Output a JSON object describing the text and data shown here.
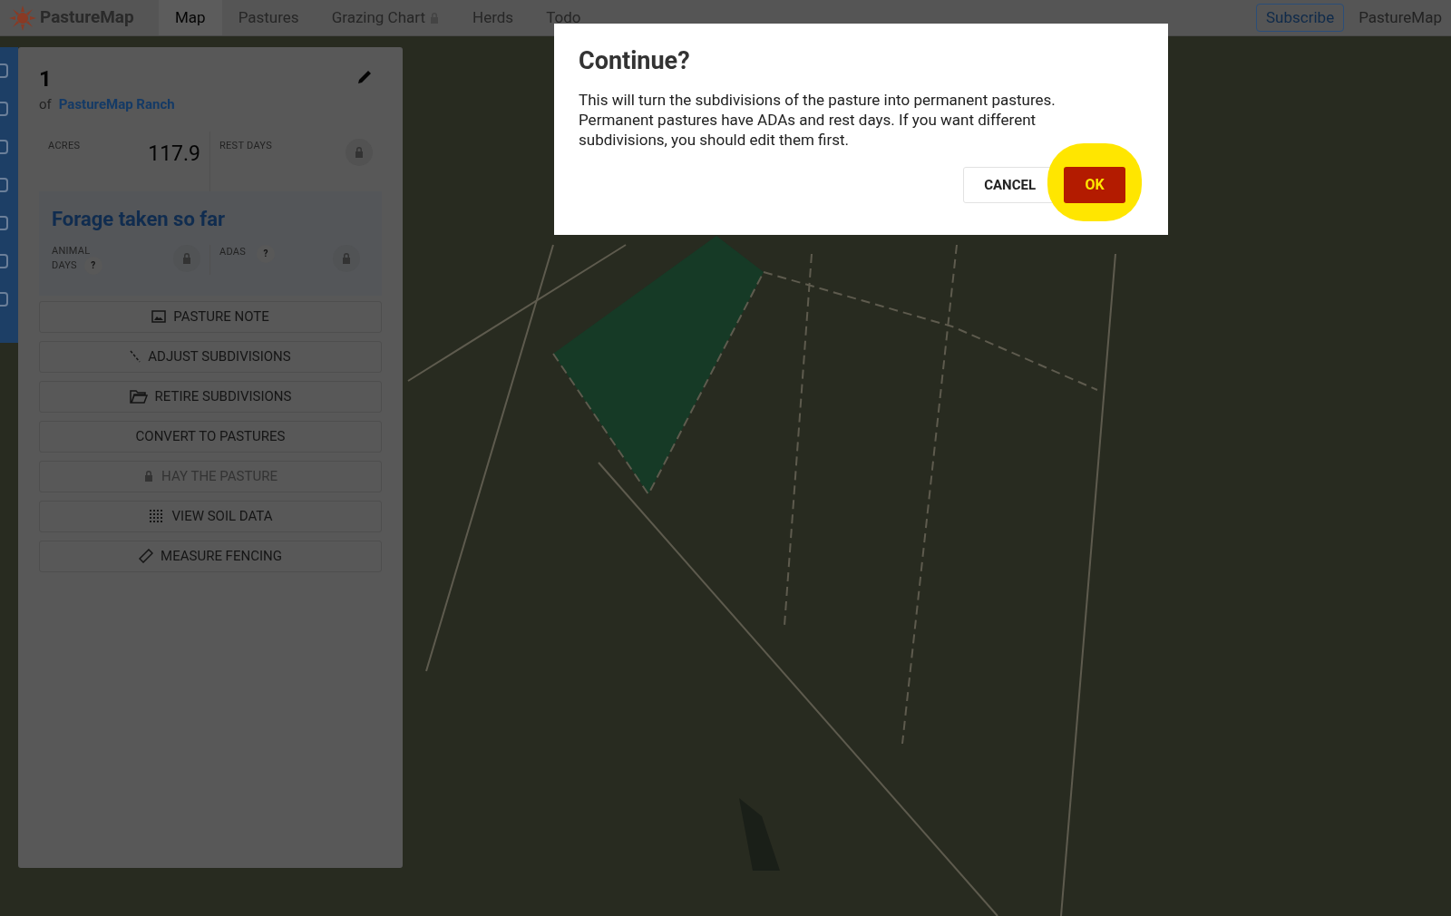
{
  "navbar": {
    "logo": "PastureMap",
    "tabs": [
      {
        "label": "Map",
        "selected": true,
        "locked": false
      },
      {
        "label": "Pastures",
        "selected": false,
        "locked": false
      },
      {
        "label": "Grazing Chart",
        "selected": false,
        "locked": true
      },
      {
        "label": "Herds",
        "selected": false,
        "locked": false
      },
      {
        "label": "Todo",
        "selected": false,
        "locked": false
      }
    ],
    "subscribe": "Subscribe",
    "account": "PastureMap"
  },
  "pasture_panel": {
    "name": "1",
    "of_label": "of",
    "ranch": "PastureMap Ranch",
    "acres_label": "ACRES",
    "acres": "117.9",
    "rest_days_label": "REST DAYS",
    "forage_title": "Forage taken so far",
    "animal_days_label_1": "ANIMAL",
    "animal_days_label_2": "DAYS",
    "help_1": "?",
    "adas_label": "ADAS",
    "help_2": "?",
    "actions": [
      {
        "label": "PASTURE NOTE",
        "kind": "note",
        "disabled": false
      },
      {
        "label": "ADJUST SUBDIVISIONS",
        "kind": "line",
        "disabled": false
      },
      {
        "label": "RETIRE SUBDIVISIONS",
        "kind": "folder",
        "disabled": false
      },
      {
        "label": "CONVERT TO PASTURES",
        "kind": "plain",
        "disabled": false
      },
      {
        "label": "HAY THE PASTURE",
        "kind": "locked",
        "disabled": true
      },
      {
        "label": "VIEW SOIL DATA",
        "kind": "grid",
        "disabled": false
      },
      {
        "label": "MEASURE FENCING",
        "kind": "ruler",
        "disabled": false
      }
    ]
  },
  "dialog": {
    "title": "Continue?",
    "message": "This will turn the subdivisions of the pasture into permanent pastures. Permanent pastures have ADAs and rest days. If you want different subdivisions, you should edit them first.",
    "cancel": "CANCEL",
    "ok": "OK",
    "ok_highlighted": true
  }
}
